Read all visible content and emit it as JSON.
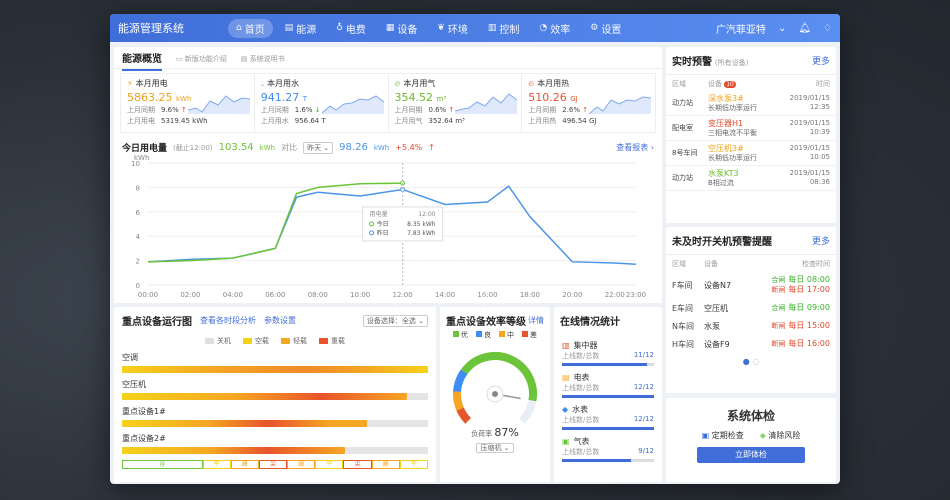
{
  "app_title": "能源管理系统",
  "nav": [
    {
      "icon": "home-icon",
      "label": "首页",
      "active": true
    },
    {
      "icon": "energy-icon",
      "label": "能源"
    },
    {
      "icon": "bulb-icon",
      "label": "电费"
    },
    {
      "icon": "device-icon",
      "label": "设备"
    },
    {
      "icon": "leaf-icon",
      "label": "环境"
    },
    {
      "icon": "control-icon",
      "label": "控制"
    },
    {
      "icon": "efficiency-icon",
      "label": "效率"
    },
    {
      "icon": "gear-icon",
      "label": "设置"
    }
  ],
  "user": "广汽菲亚特",
  "overview": {
    "title": "能源概览",
    "tab2": "新版功能介绍",
    "tab3": "系统说明书",
    "stats": [
      {
        "name": "本月用电",
        "value": "5863.25",
        "unit": "kWh",
        "color": "#f0a017",
        "ratio": "9.6%",
        "ratio_dir": "up",
        "last_label": "上月用电",
        "last": "5319.45 kWh"
      },
      {
        "name": "本月用水",
        "value": "941.27",
        "unit": "T",
        "color": "#3f8df0",
        "ratio": "1.6%",
        "ratio_dir": "down",
        "last_label": "上月用水",
        "last": "956.64 T"
      },
      {
        "name": "本月用气",
        "value": "354.52",
        "unit": "m³",
        "color": "#6bb82b",
        "ratio": "0.6%",
        "ratio_dir": "up",
        "last_label": "上月用气",
        "last": "352.64 m³"
      },
      {
        "name": "本月用热",
        "value": "510.26",
        "unit": "GJ",
        "color": "#e8542c",
        "ratio": "2.6%",
        "ratio_dir": "up",
        "last_label": "上月用热",
        "last": "496.54 GJ"
      }
    ],
    "same_period_label": "上月同期",
    "day": {
      "title": "今日用电量",
      "asof": "(截止12:00)",
      "today": "103.54",
      "unit": "kWh",
      "compare_label": "对比",
      "compare_sel": "昨天",
      "yesterday": "98.26",
      "yunit": "kWh",
      "delta": "+5.4%",
      "report": "查看报表 ›"
    }
  },
  "chart_data": {
    "type": "line",
    "ylabel": "kWh",
    "x": [
      "00:00",
      "02:00",
      "04:00",
      "06:00",
      "08:00",
      "10:00",
      "12:00",
      "14:00",
      "16:00",
      "18:00",
      "20:00",
      "22:00",
      "23:00"
    ],
    "ylim": [
      0,
      10
    ],
    "yticks": [
      0,
      2,
      4,
      6,
      8,
      10
    ],
    "series": [
      {
        "name": "今日",
        "color": "#6bc43a",
        "x": [
          0,
          2,
          4,
          6,
          7,
          8,
          10,
          12
        ],
        "values": [
          1.9,
          2.0,
          2.2,
          3.0,
          7.5,
          8.0,
          8.3,
          8.35
        ]
      },
      {
        "name": "昨日",
        "color": "#4b95e8",
        "x": [
          0,
          2,
          4,
          6,
          7,
          8,
          10,
          12,
          14,
          16,
          17,
          18,
          20,
          22,
          23
        ],
        "values": [
          1.9,
          2.1,
          2.2,
          3.0,
          7.2,
          7.6,
          7.3,
          7.83,
          6.6,
          6.8,
          8.1,
          5.6,
          1.9,
          1.8,
          1.7
        ]
      }
    ],
    "tooltip": {
      "title": "用电量",
      "time": "12:00",
      "today_label": "今日",
      "today": "8.35 kWh",
      "yest_label": "昨日",
      "yest": "7.83 kWh"
    }
  },
  "alerts": {
    "title": "实时预警",
    "sub": "(所有设备)",
    "more": "更多",
    "cols": [
      "区域",
      "设备",
      "时间"
    ],
    "badge": "10",
    "rows": [
      {
        "area": "动力站",
        "dev": "深水泵3#",
        "color": "#f0a017",
        "desc": "长期低功率运行",
        "date": "2019/01/15",
        "time": "12:35"
      },
      {
        "area": "配电室",
        "dev": "变压器H1",
        "color": "#e24a2c",
        "desc": "三相电流不平衡",
        "date": "2019/01/15",
        "time": "10:39"
      },
      {
        "area": "8号车间",
        "dev": "空压机3#",
        "color": "#f0a017",
        "desc": "长期低功率运行",
        "date": "2019/01/15",
        "time": "10:05"
      },
      {
        "area": "动力站",
        "dev": "水泵KT3",
        "color": "#6bb82b",
        "desc": "B相过流",
        "date": "2019/01/15",
        "time": "08:36"
      }
    ]
  },
  "shutdown": {
    "title": "未及时开关机预警提醒",
    "more": "更多",
    "cols": [
      "区域",
      "设备",
      "检查时间"
    ],
    "rows": [
      {
        "area": "F车间",
        "dev": "设备N7",
        "st": [
          "合闸",
          "断闸"
        ],
        "times": [
          "每日 08:00",
          "每日 17:00"
        ]
      },
      {
        "area": "E车间",
        "dev": "空压机",
        "st": [
          "合闸"
        ],
        "times": [
          "每日 09:00"
        ]
      },
      {
        "area": "N车间",
        "dev": "水泵",
        "st": [
          "断闸"
        ],
        "times": [
          "每日 15:00"
        ]
      },
      {
        "area": "H车间",
        "dev": "设备F9",
        "st": [
          "断闸"
        ],
        "times": [
          "每日 16:00"
        ]
      }
    ]
  },
  "health": {
    "title": "系统体检",
    "check": "定期检查",
    "clear": "清除风险",
    "button": "立即体检"
  },
  "devices": {
    "title": "重点设备运行图",
    "link1": "查看各时段分析",
    "link2": "参数设置",
    "select": "设备选择：全选",
    "legend": [
      {
        "name": "关机",
        "color": "#e0e0e0"
      },
      {
        "name": "空载",
        "color": "#f5d21a"
      },
      {
        "name": "轻载",
        "color": "#f5a623"
      },
      {
        "name": "重载",
        "color": "#e8542c"
      }
    ],
    "rows": [
      {
        "name": "空调",
        "fill": 1.0
      },
      {
        "name": "空压机",
        "fill": 0.93
      },
      {
        "name": "重点设备1#",
        "fill": 0.8
      },
      {
        "name": "重点设备2#",
        "fill": 0.73
      }
    ],
    "scale": [
      "谷",
      "平",
      "峰",
      "尖",
      "峰",
      "平",
      "尖",
      "峰",
      "平"
    ]
  },
  "efficiency": {
    "title": "重点设备效率等级",
    "link": "详情",
    "levels": [
      {
        "name": "优",
        "color": "#6bc43a"
      },
      {
        "name": "良",
        "color": "#3f8df0"
      },
      {
        "name": "中",
        "color": "#f5a623"
      },
      {
        "name": "差",
        "color": "#e8542c"
      }
    ],
    "load_label": "负荷率",
    "load": "87%",
    "load_value": 87,
    "select": "压缩机"
  },
  "online": {
    "title": "在线情况统计",
    "sub_label": "上线数/总数",
    "items": [
      {
        "name": "集中器",
        "icon": "concentrator-icon",
        "color": "#e8542c",
        "val": "11/12",
        "ratio": 0.92
      },
      {
        "name": "电表",
        "icon": "meter-icon",
        "color": "#f5a623",
        "val": "12/12",
        "ratio": 1.0
      },
      {
        "name": "水表",
        "icon": "water-icon",
        "color": "#3f8df0",
        "val": "12/12",
        "ratio": 1.0
      },
      {
        "name": "气表",
        "icon": "gas-icon",
        "color": "#6bc43a",
        "val": "9/12",
        "ratio": 0.75
      }
    ]
  }
}
